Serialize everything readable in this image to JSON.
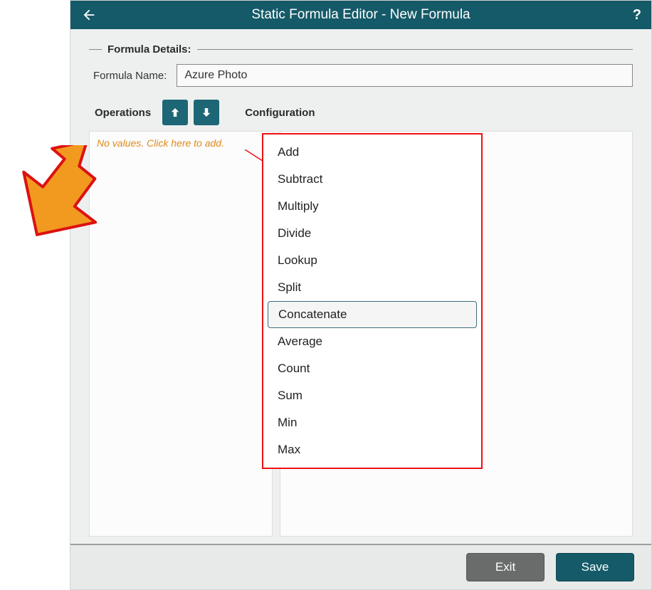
{
  "title": "Static Formula Editor - New Formula",
  "help_glyph": "?",
  "sections": {
    "details_label": "Formula Details:",
    "operations_label": "Operations",
    "configuration_label": "Configuration"
  },
  "form": {
    "name_label": "Formula Name:",
    "name_value": "Azure Photo"
  },
  "operations_panel": {
    "placeholder": "No values. Click here to add."
  },
  "dropdown": {
    "items": [
      "Add",
      "Subtract",
      "Multiply",
      "Divide",
      "Lookup",
      "Split",
      "Concatenate",
      "Average",
      "Count",
      "Sum",
      "Min",
      "Max"
    ],
    "hovered_index": 6
  },
  "footer": {
    "exit_label": "Exit",
    "save_label": "Save"
  }
}
